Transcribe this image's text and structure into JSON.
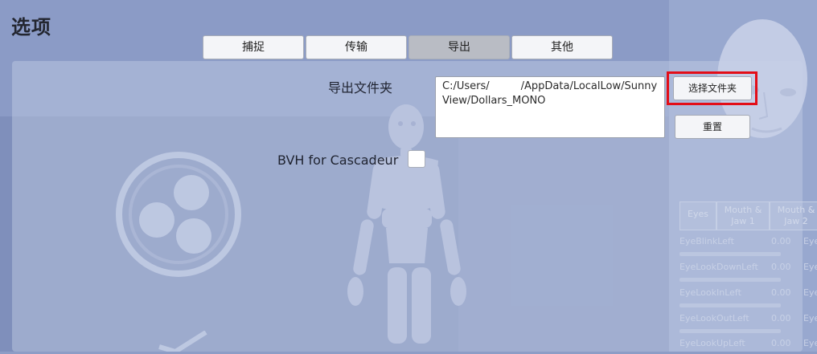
{
  "window": {
    "title": "选项"
  },
  "tabs": [
    {
      "label": "捕捉",
      "active": false
    },
    {
      "label": "传输",
      "active": false
    },
    {
      "label": "导出",
      "active": true
    },
    {
      "label": "其他",
      "active": false
    }
  ],
  "export": {
    "folder_label": "导出文件夹",
    "folder_path_line1": "C:/Users/   /AppData/LocalLow/Sunny",
    "folder_path_line2": "View/Dollars_MONO",
    "select_folder_button": "选择文件夹",
    "reset_button": "重置",
    "bvh_label": "BVH for Cascadeur",
    "bvh_checked": false
  },
  "background": {
    "blendshape_tabs": [
      "Eyes",
      "Mouth & Jaw 1",
      "Mouth & Jaw 2"
    ],
    "blendshape_rows": [
      {
        "name": "EyeBlinkLeft",
        "value": "0.00",
        "extra": "Eye"
      },
      {
        "name": "EyeLookDownLeft",
        "value": "0.00",
        "extra": "Eye"
      },
      {
        "name": "EyeLookInLeft",
        "value": "0.00",
        "extra": "Eye"
      },
      {
        "name": "EyeLookOutLeft",
        "value": "0.00",
        "extra": "Eye"
      },
      {
        "name": "EyeLookUpLeft",
        "value": "0.00",
        "extra": "Eye"
      }
    ]
  },
  "colors": {
    "highlight": "#e30d17",
    "panel": "#c8d2e8",
    "background": "#8d9dc6"
  }
}
